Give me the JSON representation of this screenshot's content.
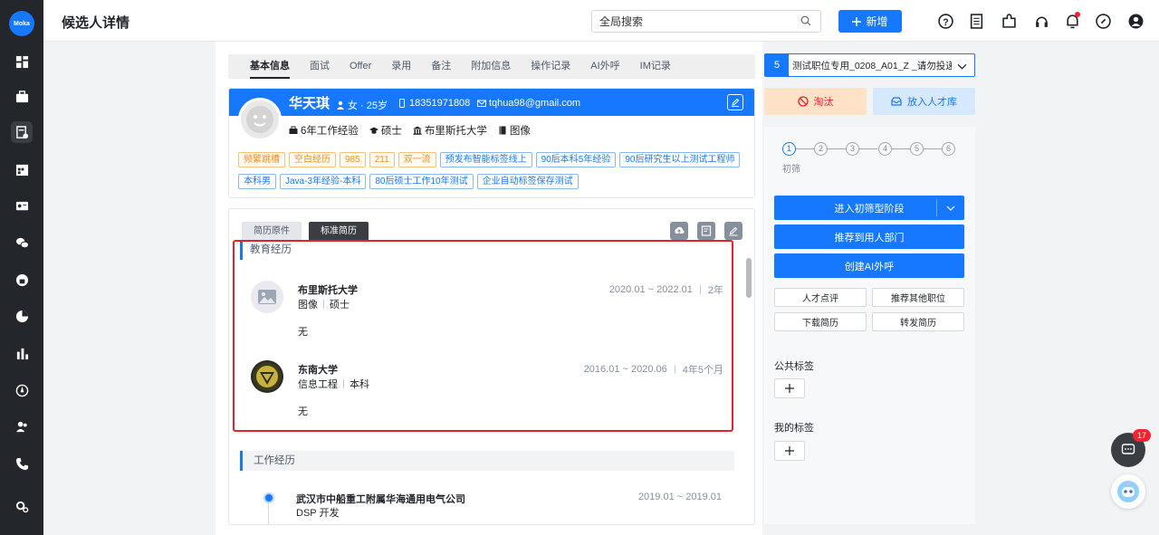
{
  "app": {
    "logo_text": "Moka",
    "page_title": "候选人详情"
  },
  "header": {
    "search_placeholder": "全局搜索",
    "add_label": "新增"
  },
  "tabs": [
    "基本信息",
    "面试",
    "Offer",
    "录用",
    "备注",
    "附加信息",
    "操作记录",
    "AI外呼",
    "IM记录"
  ],
  "candidate": {
    "name": "华天琪",
    "gender_age": "女 · 25岁",
    "phone": "18351971808",
    "email": "tqhua98@gmail.com",
    "experience": "6年工作经验",
    "degree": "硕士",
    "school": "布里斯托大学",
    "major": "图像",
    "tags_row1": [
      "频繁跳槽",
      "空白经历",
      "985",
      "211",
      "双一流",
      "预发布智能标签线上",
      "90后本科5年经验",
      "90后研究生以上测试工程师"
    ],
    "tags_row2": [
      "本科男",
      "Java-3年经验-本科",
      "80后硕士工作10年测试",
      "企业自动标签保存测试"
    ]
  },
  "resume": {
    "tab_original": "简历原件",
    "tab_standard": "标准简历",
    "education_title": "教育经历",
    "education": [
      {
        "school": "布里斯托大学",
        "major": "图像",
        "degree": "硕士",
        "date": "2020.01 ~ 2022.01",
        "duration": "2年",
        "desc": "无"
      },
      {
        "school": "东南大学",
        "major": "信息工程",
        "degree": "本科",
        "date": "2016.01 ~ 2020.06",
        "duration": "4年5个月",
        "desc": "无"
      }
    ],
    "work_title": "工作经历",
    "work": [
      {
        "company": "武汉市中船重工附属华海通用电气公司",
        "position": "DSP 开发",
        "date": "2019.01 ~ 2019.01"
      }
    ]
  },
  "sidepanel": {
    "job_number": "5",
    "job_name": "测试职位专用_0208_A01_Z _请勿投递",
    "reject_label": "淘汰",
    "talent_label": "放入人才库",
    "steps": [
      "1",
      "2",
      "3",
      "4",
      "5",
      "6"
    ],
    "current_step_label": "初筛",
    "enter_stage": "进入初筛型阶段",
    "recommend": "推荐到用人部门",
    "create_ai_call": "创建AI外呼",
    "talent_review": "人才点评",
    "recommend_other": "推荐其他职位",
    "download_resume": "下载简历",
    "forward_resume": "转发简历",
    "public_tags": "公共标签",
    "my_tags": "我的标签"
  },
  "chat": {
    "unread": "17"
  },
  "colors": {
    "primary": "#1677ff",
    "danger": "#e8202c",
    "sidebar": "#23262b"
  }
}
